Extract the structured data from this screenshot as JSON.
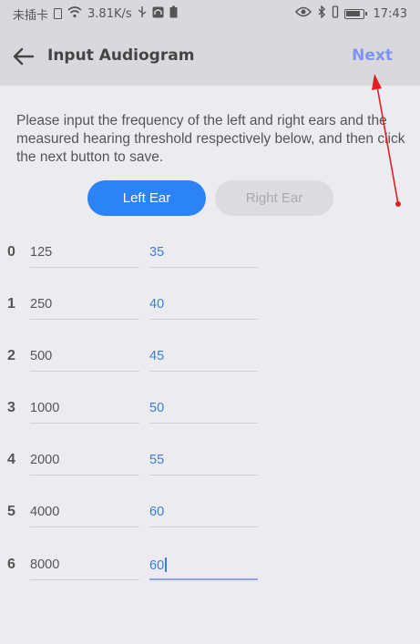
{
  "status_bar": {
    "left_text": "未插卡",
    "speed": "3.81K/s",
    "time": "17:43"
  },
  "header": {
    "title": "Input Audiogram",
    "next_label": "Next"
  },
  "instructions": "Please input the frequency of the left and right ears and the measured hearing threshold respectively below, and then click the next button to save.",
  "ear_toggle": {
    "left_label": "Left Ear",
    "right_label": "Right Ear",
    "selected": "left"
  },
  "rows": [
    {
      "index": "0",
      "frequency": "125",
      "threshold": "35"
    },
    {
      "index": "1",
      "frequency": "250",
      "threshold": "40"
    },
    {
      "index": "2",
      "frequency": "500",
      "threshold": "45"
    },
    {
      "index": "3",
      "frequency": "1000",
      "threshold": "50"
    },
    {
      "index": "4",
      "frequency": "2000",
      "threshold": "55"
    },
    {
      "index": "5",
      "frequency": "4000",
      "threshold": "60"
    },
    {
      "index": "6",
      "frequency": "8000",
      "threshold": "60"
    }
  ],
  "colors": {
    "accent": "#2b83f5",
    "next": "#7f93f0",
    "threshold_text": "#3b7ee0",
    "annotation": "#e02020"
  }
}
